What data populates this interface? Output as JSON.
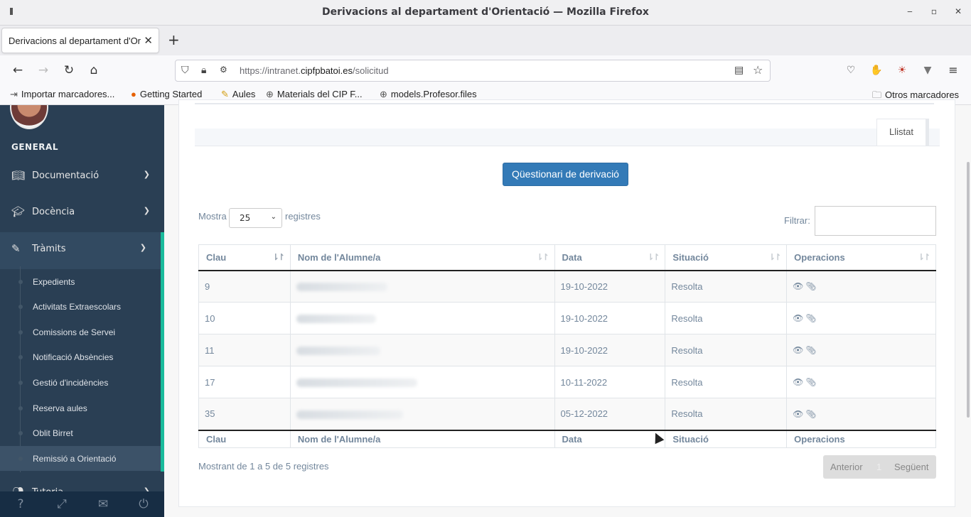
{
  "window": {
    "title": "Derivacions al departament d'Orientació — Mozilla Firefox"
  },
  "tab": {
    "label": "Derivacions al departament d'Orientació",
    "new_tab": "+"
  },
  "url": {
    "prefix": "https://intranet.",
    "domain": "cipfpbatoi.es",
    "path": "/solicitud"
  },
  "bookmarks": [
    {
      "label": "Importar marcadores..."
    },
    {
      "label": "Getting Started"
    },
    {
      "label": "Aules"
    },
    {
      "label": "Materials del CIP F..."
    },
    {
      "label": "models.Profesor.files"
    },
    {
      "label": "Otros marcadores"
    }
  ],
  "sidebar": {
    "section": "GENERAL",
    "menu": [
      {
        "label": "Documentació"
      },
      {
        "label": "Docència"
      },
      {
        "label": "Tràmits"
      }
    ],
    "submenu": [
      {
        "label": "Expedients"
      },
      {
        "label": "Activitats Extraescolars"
      },
      {
        "label": "Comissions de Servei"
      },
      {
        "label": "Notificació Absències"
      },
      {
        "label": "Gestió d'incidències"
      },
      {
        "label": "Reserva aules"
      },
      {
        "label": "Oblit Birret"
      },
      {
        "label": "Remissió a Orientació"
      }
    ],
    "next_menu": "Tutoria"
  },
  "content": {
    "tab_label": "Llistat",
    "questionnaire_button": "Qüestionari de derivació",
    "show_label": "Mostra",
    "show_value": "25",
    "records_label": "registres",
    "filter_label": "Filtrar:",
    "table": {
      "columns": [
        "Clau",
        "Nom de l'Alumne/a",
        "Data",
        "Situació",
        "Operacions"
      ],
      "rows": [
        {
          "clau": "9",
          "data": "19-10-2022",
          "situacio": "Resolta"
        },
        {
          "clau": "10",
          "data": "19-10-2022",
          "situacio": "Resolta"
        },
        {
          "clau": "11",
          "data": "19-10-2022",
          "situacio": "Resolta"
        },
        {
          "clau": "17",
          "data": "10-11-2022",
          "situacio": "Resolta"
        },
        {
          "clau": "35",
          "data": "05-12-2022",
          "situacio": "Resolta"
        }
      ]
    },
    "showing_text": "Mostrant de 1 a 5 de 5 registres",
    "pager": {
      "prev": "Anterior",
      "page": "1",
      "next": "Següent"
    }
  },
  "colors": {
    "sidebar_bg": "#2a3f54",
    "accent": "#1abb9c",
    "button": "#337ab7",
    "text_muted": "#73879c"
  }
}
